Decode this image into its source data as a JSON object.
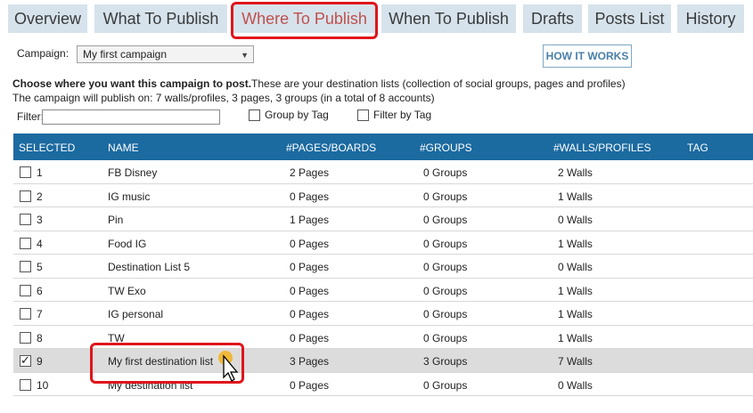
{
  "tabs": [
    {
      "label": "Overview"
    },
    {
      "label": "What To Publish"
    },
    {
      "label": "Where To Publish"
    },
    {
      "label": "When To Publish"
    },
    {
      "label": "Drafts"
    },
    {
      "label": "Posts List"
    },
    {
      "label": "History"
    }
  ],
  "active_tab": "Where To Publish",
  "campaign": {
    "label": "Campaign:",
    "selected": "My first campaign"
  },
  "how_it_works_label": "HOW IT WORKS",
  "info": {
    "bold": "Choose where you want this campaign to post.",
    "rest": "These are your destination lists (collection of social groups, pages and profiles)",
    "summary": "The campaign will publish on: 7 walls/profiles, 3 pages, 3 groups (in a total of 8 accounts)"
  },
  "filter": {
    "label": "Filter:",
    "value": "",
    "group_by_tag": "Group by Tag",
    "filter_by_tag": "Filter by Tag"
  },
  "table": {
    "headers": [
      "SELECTED",
      "NAME",
      "#PAGES/BOARDS",
      "#GROUPS",
      "#WALLS/PROFILES",
      "TAG"
    ],
    "rows": [
      {
        "num": "1",
        "name": "FB Disney",
        "pages": "2 Pages",
        "groups": "0 Groups",
        "walls": "2 Walls",
        "tag": "",
        "selected": false
      },
      {
        "num": "2",
        "name": "IG music",
        "pages": "0 Pages",
        "groups": "0 Groups",
        "walls": "1 Walls",
        "tag": "",
        "selected": false
      },
      {
        "num": "3",
        "name": "Pin",
        "pages": "1 Pages",
        "groups": "0 Groups",
        "walls": "0 Walls",
        "tag": "",
        "selected": false
      },
      {
        "num": "4",
        "name": "Food IG",
        "pages": "0 Pages",
        "groups": "0 Groups",
        "walls": "1 Walls",
        "tag": "",
        "selected": false
      },
      {
        "num": "5",
        "name": "Destination List 5",
        "pages": "0 Pages",
        "groups": "0 Groups",
        "walls": "0 Walls",
        "tag": "",
        "selected": false
      },
      {
        "num": "6",
        "name": "TW Exo",
        "pages": "0 Pages",
        "groups": "0 Groups",
        "walls": "1 Walls",
        "tag": "",
        "selected": false
      },
      {
        "num": "7",
        "name": "IG personal",
        "pages": "0 Pages",
        "groups": "0 Groups",
        "walls": "1 Walls",
        "tag": "",
        "selected": false
      },
      {
        "num": "8",
        "name": "TW",
        "pages": "0 Pages",
        "groups": "0 Groups",
        "walls": "1 Walls",
        "tag": "",
        "selected": false
      },
      {
        "num": "9",
        "name": "My first destination list",
        "pages": "3 Pages",
        "groups": "3 Groups",
        "walls": "7 Walls",
        "tag": "",
        "selected": true
      },
      {
        "num": "10",
        "name": "My destination list",
        "pages": "0 Pages",
        "groups": "0 Groups",
        "walls": "0 Walls",
        "tag": "",
        "selected": false
      }
    ]
  },
  "colors": {
    "tab_bg": "#d6e3ec",
    "active_tab_text": "#c0504d",
    "header_bg": "#1b6aa0",
    "highlight": "#e0151b",
    "selected_row": "#dcdcdc"
  },
  "icons": {
    "dropdown": "chevron-down-icon",
    "cursor": "pointer-cursor-icon"
  }
}
